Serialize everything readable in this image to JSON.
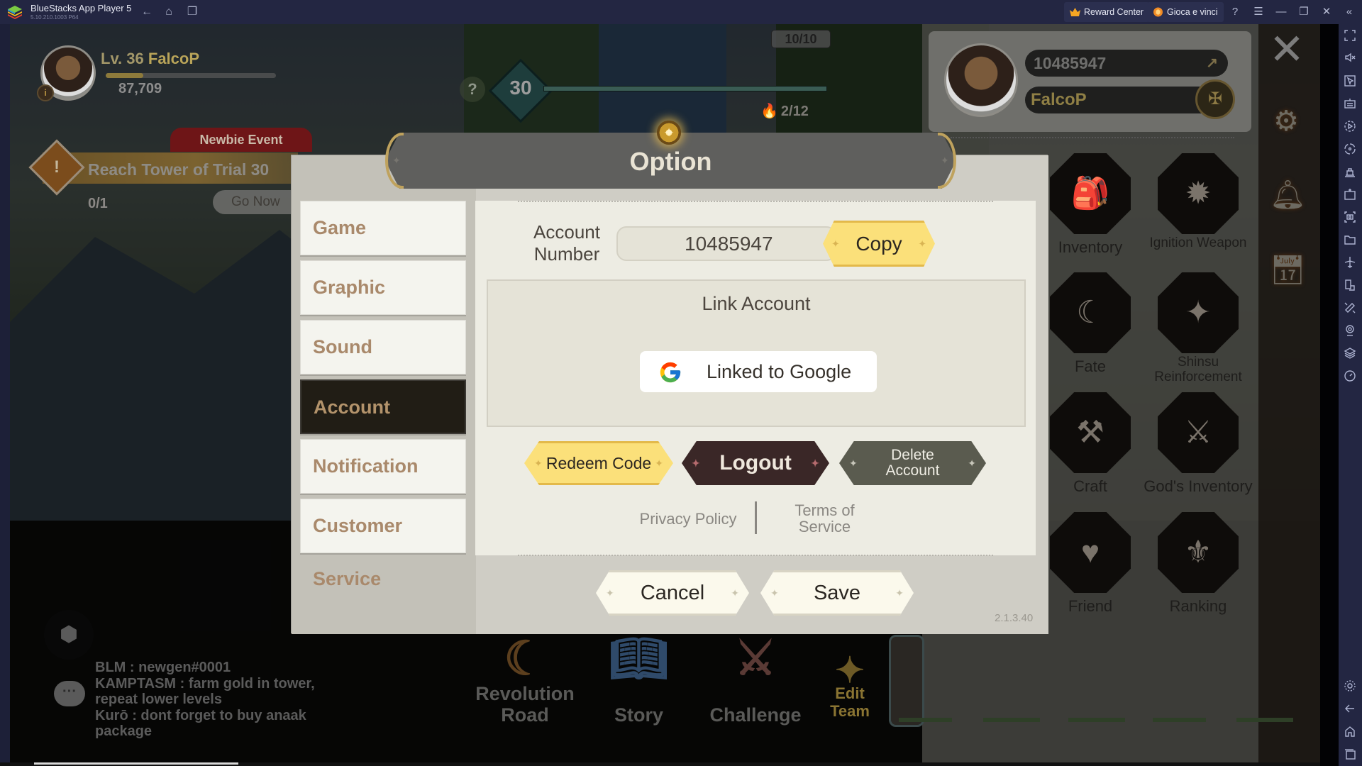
{
  "window": {
    "app_title": "BlueStacks App Player 5",
    "version": "5.10.210.1003  P64",
    "reward_center": "Reward Center",
    "promo": "Gioca e vinci"
  },
  "hud": {
    "level_label": "Lv. 36",
    "player_name": "FalcoP",
    "xp_progress": 0.22,
    "power": "87,709",
    "info_icon": "i"
  },
  "event": {
    "tag": "Newbie Event",
    "quest": "Reach Tower of Trial 30",
    "progress": "0/1",
    "go_now": "Go Now"
  },
  "tower": {
    "help": "?",
    "floor": "30",
    "tries": "10/10",
    "stamina": "2/12"
  },
  "profile_panel": {
    "account_id": "10485947",
    "player_name": "FalcoP",
    "menu": [
      {
        "label": "Inventory",
        "icon": "backpack-icon",
        "glyph": "🎒"
      },
      {
        "label": "Ignition Weapon",
        "icon": "sun-moon-icon",
        "glyph": "✹"
      },
      {
        "label": "Fate",
        "icon": "hand-moon-icon",
        "glyph": "☾"
      },
      {
        "label": "Shinsu Reinforcement",
        "icon": "star-burst-icon",
        "glyph": "✦"
      },
      {
        "label": "Craft",
        "icon": "anvil-icon",
        "glyph": "⚒"
      },
      {
        "label": "God's Inventory",
        "icon": "crossed-swords-icon",
        "glyph": "⚔"
      },
      {
        "label": "Friend",
        "icon": "heart-wings-icon",
        "glyph": "♥"
      },
      {
        "label": "Ranking",
        "icon": "sword-wings-icon",
        "glyph": "⚜"
      }
    ]
  },
  "chat": {
    "lines": [
      "BLM : newgen#0001",
      "KAMPTASM : farm gold in tower, repeat lower levels",
      "Kurō : dont forget to buy anaak package"
    ]
  },
  "bottom_menu": {
    "revolution_road": "Revolution Road",
    "story": "Story",
    "challenge": "Challenge",
    "edit_team": "Edit Team"
  },
  "dialog": {
    "title": "Option",
    "nav": [
      {
        "label": "Game",
        "active": false
      },
      {
        "label": "Graphic",
        "active": false
      },
      {
        "label": "Sound",
        "active": false
      },
      {
        "label": "Account",
        "active": true
      },
      {
        "label": "Notification",
        "active": false
      },
      {
        "label": "Customer Service",
        "active": false
      }
    ],
    "account": {
      "label_line1": "Account",
      "label_line2": "Number",
      "number": "10485947",
      "copy": "Copy",
      "link_title": "Link Account",
      "google_status": "Linked to Google",
      "redeem": "Redeem Code",
      "logout": "Logout",
      "delete_line1": "Delete",
      "delete_line2": "Account",
      "privacy": "Privacy Policy",
      "terms_line1": "Terms of",
      "terms_line2": "Service"
    },
    "cancel": "Cancel",
    "save": "Save",
    "version": "2.1.3.40"
  },
  "colors": {
    "titlebar": "#232642",
    "dialog_bg": "#c3c1b8",
    "panel_bg": "#edece3",
    "nav_active": "#211d15",
    "nav_text": "#a9896b",
    "gold_button": "#fbe07a",
    "logout_button": "#3a2727",
    "delete_button": "#5a5b4f"
  }
}
